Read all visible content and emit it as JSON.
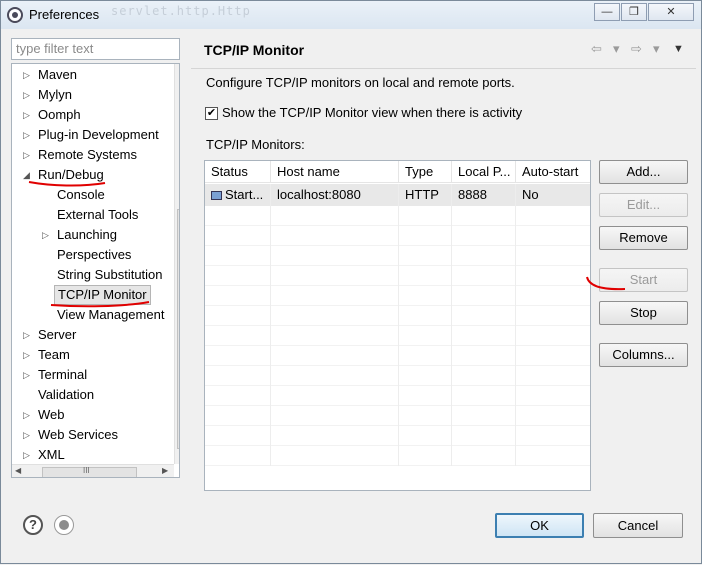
{
  "window": {
    "title": "Preferences",
    "background_code": "servlet.http.Http",
    "minimize": "—",
    "restore": "❐",
    "close": "✕"
  },
  "filter": {
    "placeholder": "type filter text"
  },
  "tree": {
    "items": [
      {
        "label": "Maven",
        "arrow": "▷"
      },
      {
        "label": "Mylyn",
        "arrow": "▷"
      },
      {
        "label": "Oomph",
        "arrow": "▷"
      },
      {
        "label": "Plug-in Development",
        "arrow": "▷"
      },
      {
        "label": "Remote Systems",
        "arrow": "▷"
      },
      {
        "label": "Run/Debug",
        "arrow": "◢"
      },
      {
        "label": "Console",
        "arrow": ""
      },
      {
        "label": "External Tools",
        "arrow": ""
      },
      {
        "label": "Launching",
        "arrow": "▷"
      },
      {
        "label": "Perspectives",
        "arrow": ""
      },
      {
        "label": "String Substitution",
        "arrow": ""
      },
      {
        "label": "TCP/IP Monitor",
        "arrow": ""
      },
      {
        "label": "View Management",
        "arrow": ""
      },
      {
        "label": "Server",
        "arrow": "▷"
      },
      {
        "label": "Team",
        "arrow": "▷"
      },
      {
        "label": "Terminal",
        "arrow": "▷"
      },
      {
        "label": "Validation",
        "arrow": ""
      },
      {
        "label": "Web",
        "arrow": "▷"
      },
      {
        "label": "Web Services",
        "arrow": "▷"
      },
      {
        "label": "XML",
        "arrow": "▷"
      }
    ],
    "hscroll_grip": "III",
    "vscroll_grip": "≡"
  },
  "panel": {
    "title": "TCP/IP Monitor",
    "description": "Configure TCP/IP monitors on local and remote ports.",
    "checkbox_label": "Show the TCP/IP Monitor view when there is activity",
    "checkbox_checked": true,
    "monitors_label": "TCP/IP Monitors:",
    "nav": {
      "back": "⇦",
      "back_menu": "▾",
      "forward": "⇨",
      "forward_menu": "▾",
      "view_menu": "▼"
    }
  },
  "table": {
    "columns": [
      "Status",
      "Host name",
      "Type",
      "Local P...",
      "Auto-start"
    ],
    "rows": [
      {
        "status": "Start...",
        "host": "localhost:8080",
        "type": "HTTP",
        "port": "8888",
        "autostart": "No"
      }
    ]
  },
  "buttons": {
    "add": "Add...",
    "edit": "Edit...",
    "remove": "Remove",
    "start": "Start",
    "stop": "Stop",
    "columns": "Columns...",
    "ok": "OK",
    "cancel": "Cancel",
    "help": "?"
  },
  "colors": {
    "annotation": "#e00000",
    "ok_border": "#3c7fb1"
  }
}
